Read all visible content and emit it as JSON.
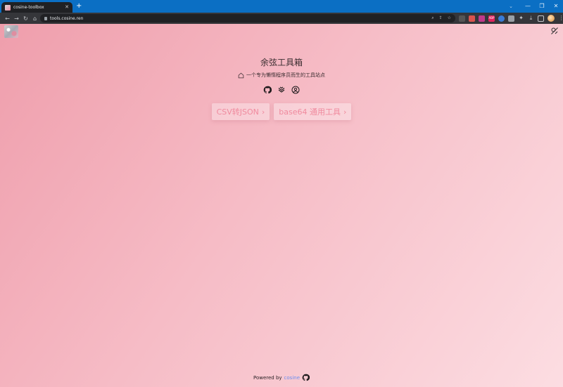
{
  "browser": {
    "tab_title": "cosine-toolbox",
    "url": "tools.cosine.ren",
    "new_tab": "+",
    "window_controls": {
      "collapse": "⌄",
      "minimize": "—",
      "restore": "❐",
      "close": "✕"
    },
    "extension_badges": [
      "",
      "",
      "",
      "ABP",
      "",
      "",
      ""
    ]
  },
  "page": {
    "title": "余弦工具箱",
    "subtitle": "一个专为懒惰程序员而生的工具站点",
    "tools": [
      {
        "label": "CSV转JSON",
        "chevron": "›"
      },
      {
        "label": "base64 通用工具",
        "chevron": "›"
      }
    ],
    "footer": {
      "powered_by": "Powered by",
      "author": "cosine"
    },
    "colors": {
      "accent": "#f08a9e",
      "gradient_start": "#ef9eac",
      "gradient_end": "#fcdde2",
      "link": "#6c8ef0"
    }
  },
  "icons": {
    "logo": "site-logo",
    "theme": "theme-toggle-icon",
    "social": [
      "github-icon",
      "layers-icon",
      "user-circle-icon"
    ],
    "subtitle": "home-icon",
    "footer": "github-icon"
  }
}
